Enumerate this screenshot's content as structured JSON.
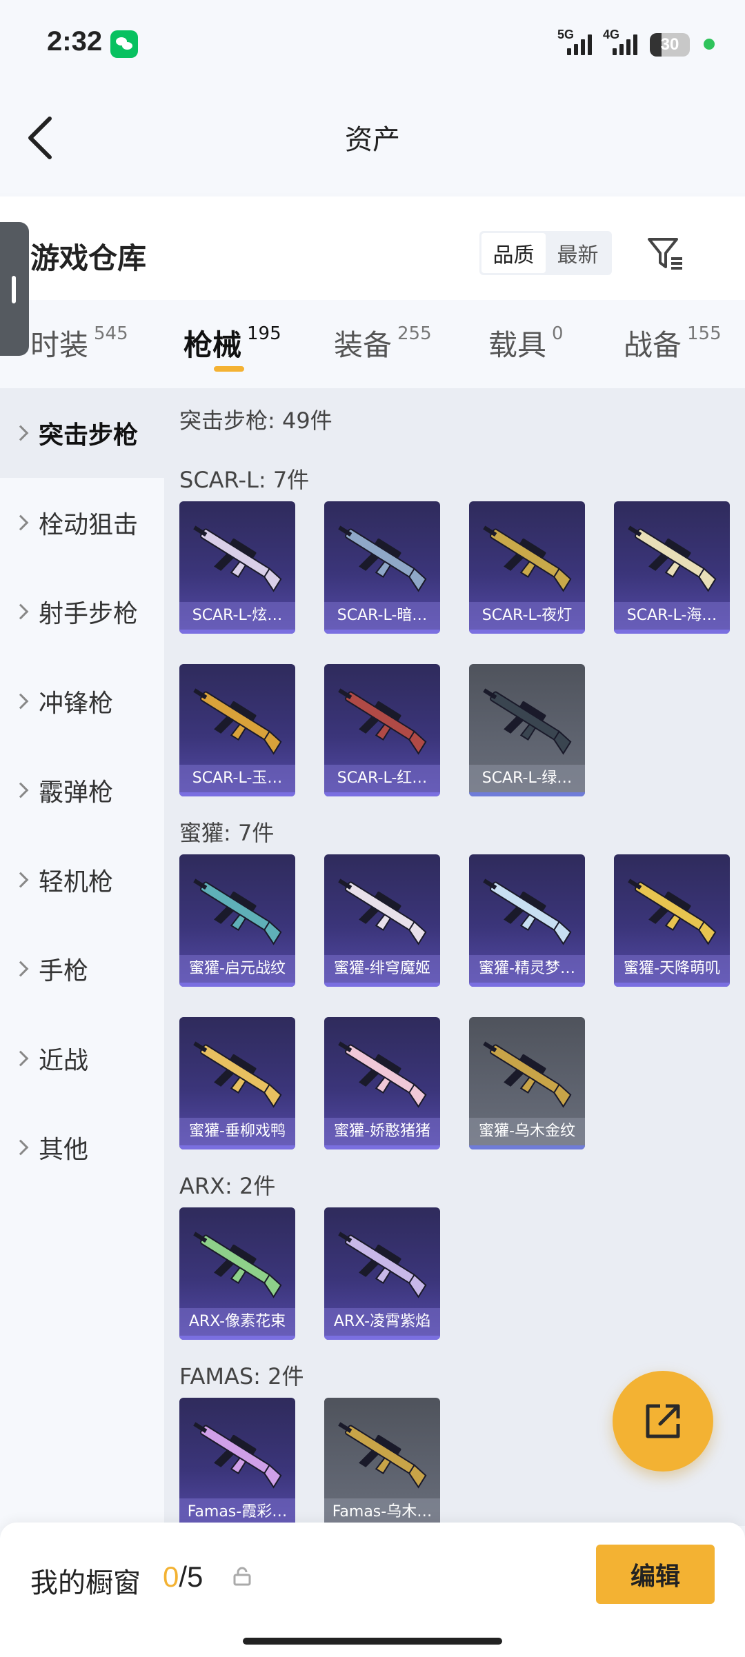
{
  "status": {
    "time": "2:32",
    "network1": "5G",
    "network2": "4G",
    "battery": "30",
    "battery_level": 0.3
  },
  "header": {
    "title": "资产"
  },
  "warehouse": {
    "title": "游戏仓库",
    "sort_options": [
      "品质",
      "最新"
    ]
  },
  "tabs": [
    {
      "label": "时装",
      "count": "545"
    },
    {
      "label": "枪械",
      "count": "195"
    },
    {
      "label": "装备",
      "count": "255"
    },
    {
      "label": "载具",
      "count": "0"
    },
    {
      "label": "战备",
      "count": "155"
    }
  ],
  "sidebar": {
    "items": [
      {
        "label": "突击步枪"
      },
      {
        "label": "栓动狙击"
      },
      {
        "label": "射手步枪"
      },
      {
        "label": "冲锋枪"
      },
      {
        "label": "霰弹枪"
      },
      {
        "label": "轻机枪"
      },
      {
        "label": "手枪"
      },
      {
        "label": "近战"
      },
      {
        "label": "其他"
      }
    ]
  },
  "content": {
    "summary": "突击步枪: 49件",
    "groups": [
      {
        "title": "SCAR-L: 7件",
        "items": [
          {
            "label": "SCAR-L-炫…",
            "gun_color": "#d9cfe8",
            "tier": "purple"
          },
          {
            "label": "SCAR-L-暗…",
            "gun_color": "#8fa8c8",
            "tier": "purple"
          },
          {
            "label": "SCAR-L-夜灯",
            "gun_color": "#c9a94a",
            "tier": "purple"
          },
          {
            "label": "SCAR-L-海…",
            "gun_color": "#e9dfb8",
            "tier": "purple"
          },
          {
            "label": "SCAR-L-玉…",
            "gun_color": "#d9a23a",
            "tier": "purple"
          },
          {
            "label": "SCAR-L-红…",
            "gun_color": "#b04a46",
            "tier": "purple"
          },
          {
            "label": "SCAR-L-绿…",
            "gun_color": "#3a4550",
            "tier": "gray"
          }
        ]
      },
      {
        "title": "蜜獾: 7件",
        "items": [
          {
            "label": "蜜獾-启元战纹",
            "gun_color": "#5fb0b8",
            "tier": "purple"
          },
          {
            "label": "蜜獾-绯穹魔姬",
            "gun_color": "#e8e0ea",
            "tier": "purple"
          },
          {
            "label": "蜜獾-精灵梦…",
            "gun_color": "#c8dff2",
            "tier": "purple"
          },
          {
            "label": "蜜獾-天降萌叽",
            "gun_color": "#e8c450",
            "tier": "purple"
          },
          {
            "label": "蜜獾-垂柳戏鸭",
            "gun_color": "#e8c060",
            "tier": "purple"
          },
          {
            "label": "蜜獾-娇憨猪猪",
            "gun_color": "#f0c8d8",
            "tier": "purple"
          },
          {
            "label": "蜜獾-乌木金纹",
            "gun_color": "#c8a448",
            "tier": "gray"
          }
        ]
      },
      {
        "title": "ARX: 2件",
        "items": [
          {
            "label": "ARX-像素花束",
            "gun_color": "#8ed08a",
            "tier": "purple"
          },
          {
            "label": "ARX-凌霄紫焰",
            "gun_color": "#c8b8e8",
            "tier": "purple"
          }
        ]
      },
      {
        "title": "FAMAS: 2件",
        "items": [
          {
            "label": "Famas-霞彩…",
            "gun_color": "#d0a0e8",
            "tier": "purple"
          },
          {
            "label": "Famas-乌木…",
            "gun_color": "#c8a448",
            "tier": "gray"
          }
        ]
      }
    ]
  },
  "bottom": {
    "window_label": "我的橱窗",
    "window_current": "0",
    "window_total": "/5",
    "edit_label": "编辑"
  },
  "colors": {
    "accent": "#f3b233",
    "card_purple": "#3b357a",
    "card_gray": "#5f6470"
  }
}
